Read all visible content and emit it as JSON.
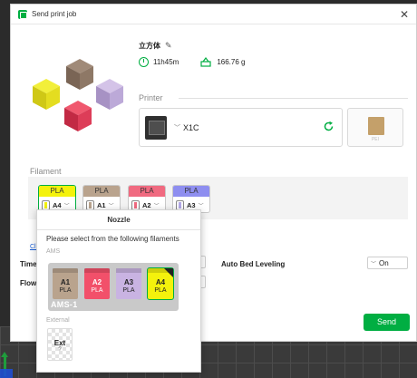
{
  "window": {
    "title": "Send print job",
    "close": "✕"
  },
  "model": {
    "name": "立方体",
    "time": "11h45m",
    "weight": "166.76 g"
  },
  "printer": {
    "section_label": "Printer",
    "name": "X1C",
    "plate_label": "PEI"
  },
  "filament": {
    "section_label": "Filament",
    "slots": [
      {
        "type": "PLA",
        "slot": "A4",
        "color": "#f4f20c",
        "selected": true
      },
      {
        "type": "PLA",
        "slot": "A1",
        "color": "#b9a38d",
        "selected": false
      },
      {
        "type": "PLA",
        "slot": "A2",
        "color": "#f06a80",
        "selected": false
      },
      {
        "type": "PLA",
        "slot": "A3",
        "color": "#b3a8e8",
        "selected": false
      }
    ]
  },
  "options": {
    "click_text": "Click",
    "timelapse_label": "Timel",
    "flow_label": "Flow",
    "bed_leveling_label": "Auto Bed Leveling",
    "bed_leveling_value": "On"
  },
  "send_button": "Send",
  "popup": {
    "title": "Nozzle",
    "hint": "Please select from the following filaments",
    "ams_section": "AMS",
    "ams_name": "AMS-1",
    "trays": [
      {
        "id": "A1",
        "type": "PLA",
        "color": "#b9a38d",
        "text_color": "#222"
      },
      {
        "id": "A2",
        "type": "PLA",
        "color": "#f2506a",
        "text_color": "#fff"
      },
      {
        "id": "A3",
        "type": "PLA",
        "color": "#c9b3e2",
        "text_color": "#222"
      },
      {
        "id": "A4",
        "type": "PLA",
        "color": "#f4f20c",
        "text_color": "#222",
        "selected": true
      }
    ],
    "external_section": "External",
    "external": {
      "label": "Ext",
      "sub": "?"
    }
  }
}
